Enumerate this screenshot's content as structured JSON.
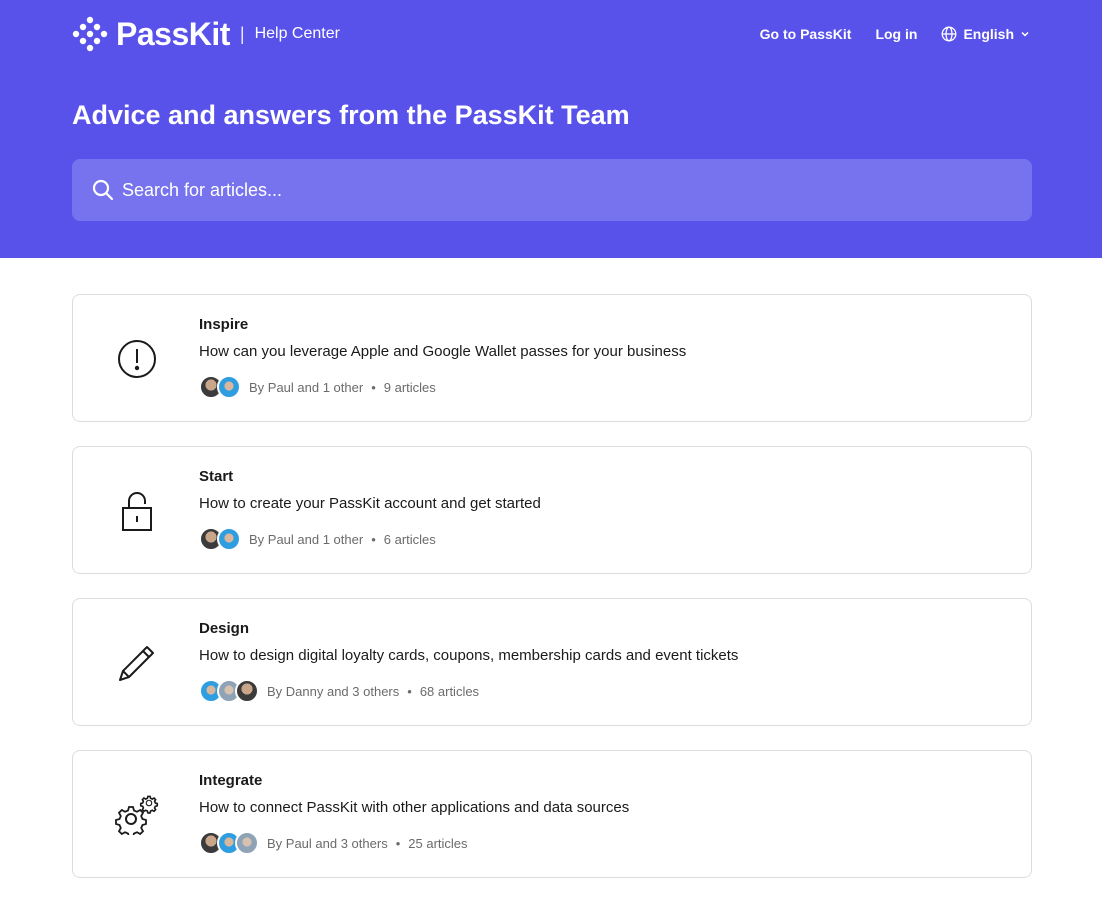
{
  "header": {
    "brand": "PassKit",
    "separator": "|",
    "subtitle": "Help Center",
    "nav": {
      "go_to": "Go to PassKit",
      "login": "Log in",
      "language": "English"
    }
  },
  "hero": {
    "title": "Advice and answers from the PassKit Team"
  },
  "search": {
    "placeholder": "Search for articles..."
  },
  "collections": [
    {
      "icon": "exclamation-circle-icon",
      "title": "Inspire",
      "description": "How can you leverage Apple and Google Wallet passes for your business",
      "authors": "By Paul and 1 other",
      "bullet": "•",
      "articles": "9 articles"
    },
    {
      "icon": "padlock-icon",
      "title": "Start",
      "description": "How to create your PassKit account and get started",
      "authors": "By Paul and 1 other",
      "bullet": "•",
      "articles": "6 articles"
    },
    {
      "icon": "pencil-icon",
      "title": "Design",
      "description": "How to design digital loyalty cards, coupons, membership cards and event tickets",
      "authors": "By Danny and 3 others",
      "bullet": "•",
      "articles": "68 articles"
    },
    {
      "icon": "gears-icon",
      "title": "Integrate",
      "description": "How to connect PassKit with other applications and data sources",
      "authors": "By Paul and 3 others",
      "bullet": "•",
      "articles": "25 articles"
    }
  ],
  "colors": {
    "hero_bg": "#5851ea",
    "search_bg": "#7773ef",
    "card_border": "#dcdcdf"
  }
}
